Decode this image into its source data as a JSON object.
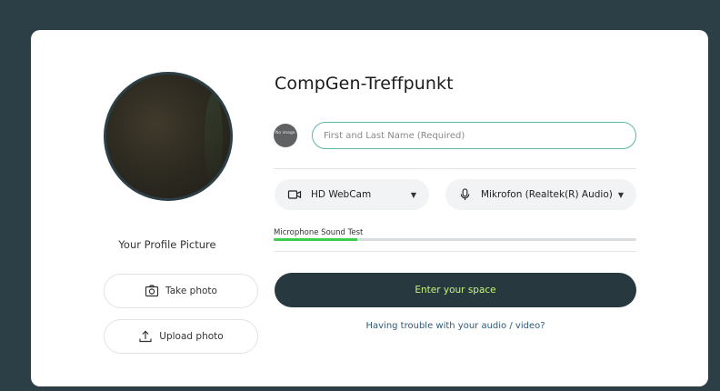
{
  "room": {
    "title": "CompGen-Treffpunkt"
  },
  "profile": {
    "label": "Your Profile Picture",
    "take_photo": "Take photo",
    "upload_photo": "Upload photo",
    "mini_avatar_text": "No image"
  },
  "name_input": {
    "placeholder": "First and Last Name (Required)",
    "value": ""
  },
  "devices": {
    "camera": {
      "selected": "HD WebCam",
      "icon": "video-camera-icon"
    },
    "microphone": {
      "selected": "Mikrofon (Realtek(R) Audio)",
      "icon": "microphone-icon"
    }
  },
  "mic_test": {
    "label": "Microphone Sound Test",
    "level": 0.23
  },
  "actions": {
    "enter": "Enter your space",
    "trouble": "Having trouble with your audio / video?"
  },
  "colors": {
    "background": "#2c3e46",
    "enter_button": "#27393f",
    "enter_text": "#c6f27a",
    "input_border": "#5cb8a8",
    "meter": "#3ccf4e"
  }
}
